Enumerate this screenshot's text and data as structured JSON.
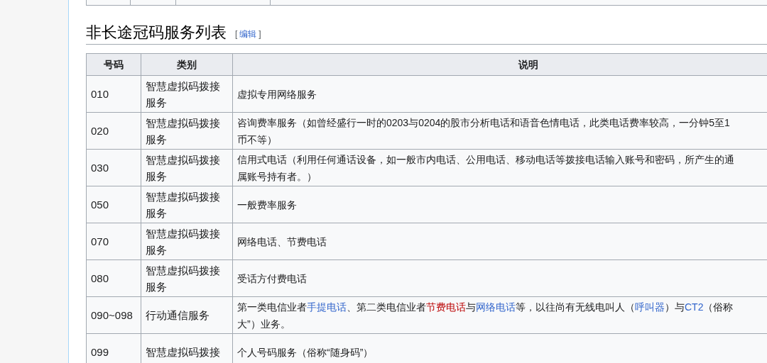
{
  "section": {
    "heading": "非长途冠码服务列表",
    "edit_link": {
      "open": "[",
      "label": "编辑",
      "close": "]"
    }
  },
  "table": {
    "columns": [
      "号码",
      "类别",
      "说明"
    ],
    "rows": [
      {
        "code": "010",
        "category": "智慧虚拟码拨接服务",
        "description": [
          [
            {
              "kind": "text",
              "text": "虚拟专用网络服务"
            }
          ]
        ]
      },
      {
        "code": "020",
        "category": "智慧虚拟码拨接服务",
        "description": [
          [
            {
              "kind": "text",
              "text": "咨询费率服务（如曾经盛行一时的0203与0204的股市分析电话和语音色情电话，此类电话费率较高，一分钟5至1"
            }
          ],
          [
            {
              "kind": "text",
              "text": "币不等）"
            }
          ]
        ]
      },
      {
        "code": "030",
        "category": "智慧虚拟码拨接服务",
        "description": [
          [
            {
              "kind": "text",
              "text": "信用式电话（利用任何通话设备，如一般市内电话、公用电话、移动电话等拨接电话输入账号和密码，所产生的通"
            }
          ],
          [
            {
              "kind": "text",
              "text": "属账号持有者。）"
            }
          ]
        ]
      },
      {
        "code": "050",
        "category": "智慧虚拟码拨接服务",
        "description": [
          [
            {
              "kind": "text",
              "text": "一般费率服务"
            }
          ]
        ]
      },
      {
        "code": "070",
        "category": "智慧虚拟码拨接服务",
        "description": [
          [
            {
              "kind": "text",
              "text": "网络电话、节费电话"
            }
          ]
        ]
      },
      {
        "code": "080",
        "category": "智慧虚拟码拨接服务",
        "description": [
          [
            {
              "kind": "text",
              "text": "受话方付费电话"
            }
          ]
        ]
      },
      {
        "code": "090~098",
        "category": "行动通信服务",
        "description": [
          [
            {
              "kind": "text",
              "text": "第一类电信业者"
            },
            {
              "kind": "link",
              "text": "手提电话"
            },
            {
              "kind": "text",
              "text": "、第二类电信业者"
            },
            {
              "kind": "redlink",
              "text": "节费电话"
            },
            {
              "kind": "text",
              "text": "与"
            },
            {
              "kind": "link",
              "text": "网络电话"
            },
            {
              "kind": "text",
              "text": "等，以往尚有无线电叫人（"
            },
            {
              "kind": "link",
              "text": "呼叫器"
            },
            {
              "kind": "text",
              "text": "）与"
            },
            {
              "kind": "link",
              "text": "CT2"
            },
            {
              "kind": "text",
              "text": "（俗称"
            }
          ],
          [
            {
              "kind": "text",
              "text": "大”）业务。"
            }
          ]
        ]
      },
      {
        "code": "099",
        "category": "智慧虚拟码拨接",
        "description": [
          [
            {
              "kind": "text",
              "text": "个人号码服务（俗称“随身码”）"
            }
          ]
        ]
      }
    ]
  }
}
